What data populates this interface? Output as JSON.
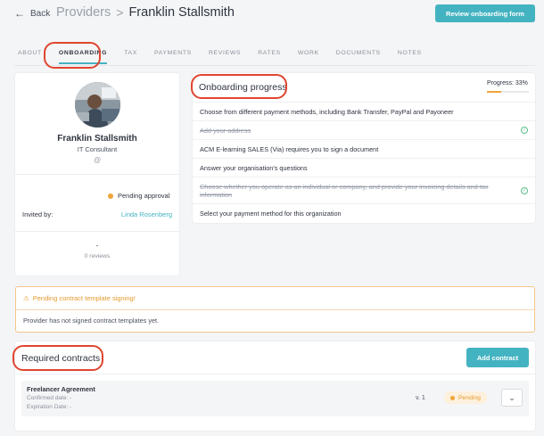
{
  "header": {
    "back_label": "Back",
    "section": "Providers",
    "separator": ">",
    "provider_name": "Franklin Stallsmith",
    "review_button": "Review onboarding form"
  },
  "tabs": [
    {
      "label": "ABOUT"
    },
    {
      "label": "ONBOARDING",
      "active": true
    },
    {
      "label": "TAX"
    },
    {
      "label": "PAYMENTS"
    },
    {
      "label": "REVIEWS"
    },
    {
      "label": "RATES"
    },
    {
      "label": "WORK"
    },
    {
      "label": "DOCUMENTS"
    },
    {
      "label": "NOTES"
    }
  ],
  "profile": {
    "name": "Franklin Stallsmith",
    "role": "IT Consultant",
    "at_symbol": "@",
    "status": "Pending approval",
    "invited_by_label": "Invited by:",
    "invited_by": "Linda Rosenberg",
    "rating": "-",
    "reviews": "0 reviews"
  },
  "onboarding": {
    "title": "Onboarding progress",
    "progress_label": "Progress: 33%",
    "progress_fraction": 0.33,
    "items": [
      {
        "text": "Choose from different payment methods, including Bank Transfer, PayPal and Payoneer",
        "done": false
      },
      {
        "text": "Add your address",
        "done": true
      },
      {
        "text": "ACM E-learning SALES (Via) requires you to sign a document",
        "done": false
      },
      {
        "text": "Answer your organisation's questions",
        "done": false
      },
      {
        "text": "Choose whether you operate as an individual or company, and provide your invoicing details and tax information",
        "done": true
      },
      {
        "text": "Select your payment method for this organization",
        "done": false
      }
    ]
  },
  "alert": {
    "title": "Pending contract template signing!",
    "body": "Provider has not signed contract templates yet."
  },
  "contracts": {
    "title": "Required contracts",
    "add_button": "Add contract",
    "rows": [
      {
        "name": "Freelancer Agreement",
        "confirmed": "Confirmed date: -",
        "expiration": "Expiration Date: -",
        "version": "v. 1",
        "status": "Pending"
      }
    ]
  },
  "colors": {
    "accent": "#44b3c1",
    "highlight_circle": "#e0452e",
    "pending": "#f0a43a"
  }
}
